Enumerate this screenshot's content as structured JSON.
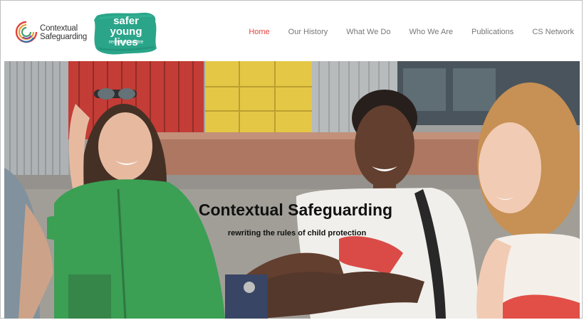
{
  "brand": {
    "primary_logo_line1": "Contextual",
    "primary_logo_line2": "Safeguarding",
    "partner_logo_line1": "safer",
    "partner_logo_line2": "young lives",
    "partner_logo_sub": "research centre"
  },
  "nav": {
    "items": [
      {
        "label": "Home",
        "active": true
      },
      {
        "label": "Our History",
        "active": false
      },
      {
        "label": "What We Do",
        "active": false
      },
      {
        "label": "Who We Are",
        "active": false
      },
      {
        "label": "Publications",
        "active": false
      },
      {
        "label": "CS Network",
        "active": false
      }
    ]
  },
  "hero": {
    "title": "Contextual Safeguarding",
    "subtitle": "rewriting the rules of child protection"
  },
  "colors": {
    "accent": "#e0453c",
    "partner_green": "#2aa58a",
    "nav_text": "#777777"
  }
}
